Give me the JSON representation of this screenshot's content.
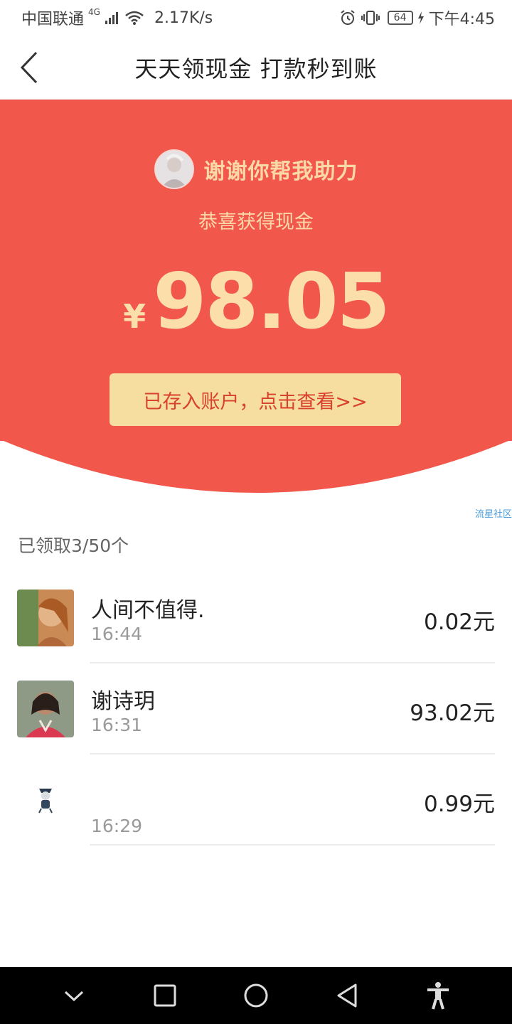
{
  "status_bar": {
    "carrier": "中国联通",
    "network": "4G",
    "speed": "2.17K/s",
    "battery": "64",
    "time": "下午4:45"
  },
  "header": {
    "title": "天天领现金 打款秒到账"
  },
  "hero": {
    "thanks_text": "谢谢你帮我助力",
    "congrats_text": "恭喜获得现金",
    "currency_symbol": "¥",
    "amount": "98.05",
    "view_button_label": "已存入账户，点击查看>>"
  },
  "watermark": "流星社区",
  "received_summary": "已领取3/50个",
  "records": [
    {
      "name": "人间不值得.",
      "time": "16:44",
      "amount": "0.02元"
    },
    {
      "name": "谢诗玥",
      "time": "16:31",
      "amount": "93.02元"
    },
    {
      "name": "",
      "time": "16:29",
      "amount": "0.99元"
    }
  ],
  "colors": {
    "hero_red": "#f1574a",
    "gold_text": "#fbd9a6",
    "button_bg": "#f5dea0",
    "button_text": "#d8402f"
  }
}
